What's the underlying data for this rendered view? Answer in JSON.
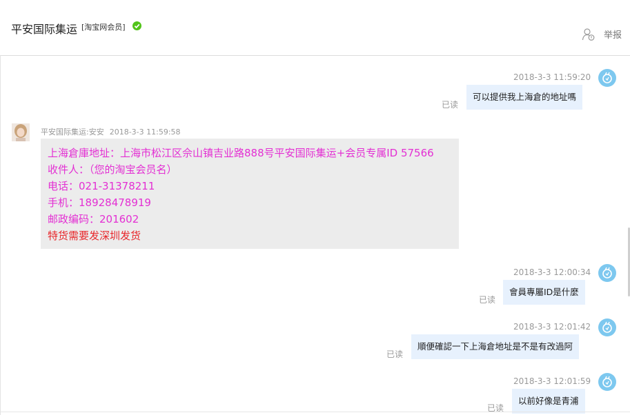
{
  "header": {
    "shop_name": "平安国际集运",
    "badge": "[淘宝网会员]",
    "report_label": "举报"
  },
  "messages": [
    {
      "time": "2018-3-3 11:59:20",
      "text": "可以提供我上海倉的地址嗎",
      "status": "已读"
    },
    {
      "sender": "平安国际集运:安安",
      "time": "2018-3-3 11:59:58",
      "lines": [
        "上海倉庫地址：上海市松江区佘山镇吉业路888号平安国际集运+会员专属ID 57566",
        "收件人：（您的淘宝会员名）",
        "电话：021-31378211",
        "手机：18928478919",
        "邮政编码：201602",
        "特货需要发深圳发货"
      ]
    },
    {
      "time": "2018-3-3 12:00:34",
      "text": "會員專屬ID是什麼",
      "status": "已读"
    },
    {
      "time": "2018-3-3 12:01:42",
      "text": "順便確認一下上海倉地址是不是有改過阿",
      "status": "已读"
    },
    {
      "time": "2018-3-3 12:01:59",
      "text": "以前好像是青浦",
      "status": "已读"
    }
  ],
  "colors": {
    "accent_text": "#e32fd3",
    "warning_text": "#e8282c",
    "outgoing_bubble": "#e7f1fd",
    "incoming_bubble": "#ececec"
  }
}
